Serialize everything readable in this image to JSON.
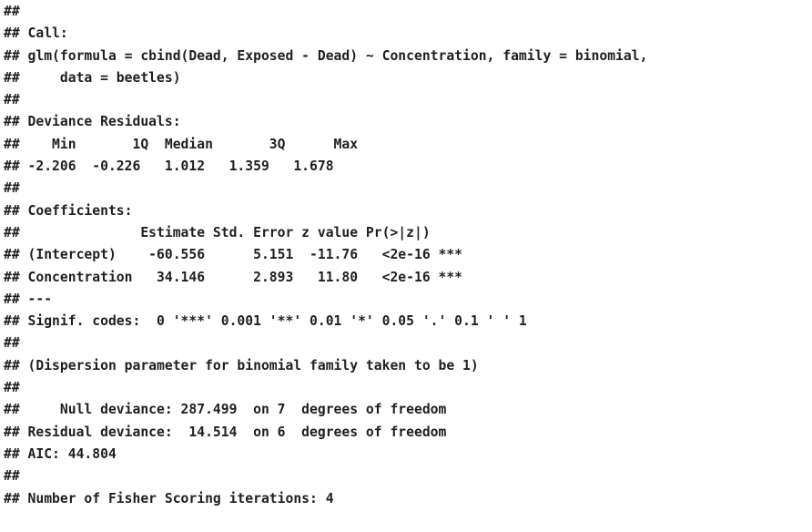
{
  "console": {
    "lines": [
      "##",
      "## Call:",
      "## glm(formula = cbind(Dead, Exposed - Dead) ~ Concentration, family = binomial,",
      "##     data = beetles)",
      "##",
      "## Deviance Residuals:",
      "##    Min       1Q  Median       3Q      Max",
      "## -2.206  -0.226   1.012   1.359   1.678",
      "##",
      "## Coefficients:",
      "##               Estimate Std. Error z value Pr(>|z|)",
      "## (Intercept)    -60.556      5.151  -11.76   <2e-16 ***",
      "## Concentration   34.146      2.893   11.80   <2e-16 ***",
      "## ---",
      "## Signif. codes:  0 '***' 0.001 '**' 0.01 '*' 0.05 '.' 0.1 ' ' 1",
      "##",
      "## (Dispersion parameter for binomial family taken to be 1)",
      "##",
      "##     Null deviance: 287.499  on 7  degrees of freedom",
      "## Residual deviance:  14.514  on 6  degrees of freedom",
      "## AIC: 44.804",
      "##",
      "## Number of Fisher Scoring iterations: 4"
    ]
  }
}
